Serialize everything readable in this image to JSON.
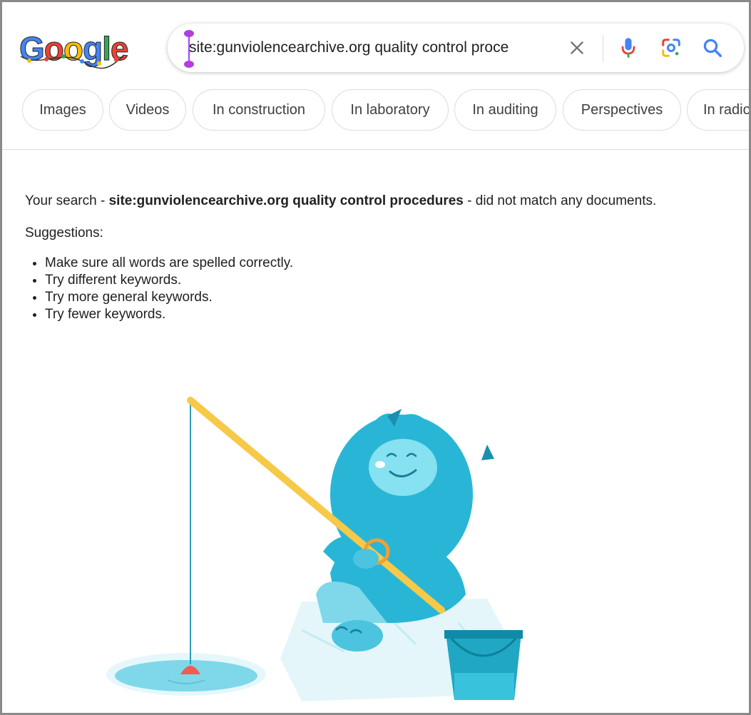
{
  "search": {
    "query": "site:gunviolencearchive.org quality control proce",
    "clear_icon": "close-icon",
    "mic_icon": "microphone-icon",
    "lens_icon": "camera-lens-icon",
    "search_icon": "search-icon"
  },
  "logo": {
    "text": "Google"
  },
  "chips": [
    {
      "label": "Images"
    },
    {
      "label": "Videos"
    },
    {
      "label": "In construction"
    },
    {
      "label": "In laboratory"
    },
    {
      "label": "In auditing"
    },
    {
      "label": "Perspectives"
    },
    {
      "label": "In radio"
    }
  ],
  "results": {
    "message_prefix": "Your search - ",
    "message_query": "site:gunviolencearchive.org quality control procedures",
    "message_suffix": " - did not match any documents.",
    "suggestions_title": "Suggestions:",
    "suggestions": [
      "Make sure all words are spelled correctly.",
      "Try different keywords.",
      "Try more general keywords.",
      "Try fewer keywords."
    ]
  },
  "colors": {
    "accent_blue": "#4285f4",
    "google_red": "#ea4335",
    "google_yellow": "#fbbc05",
    "google_green": "#34a853",
    "yeti": "#29b6d6"
  }
}
